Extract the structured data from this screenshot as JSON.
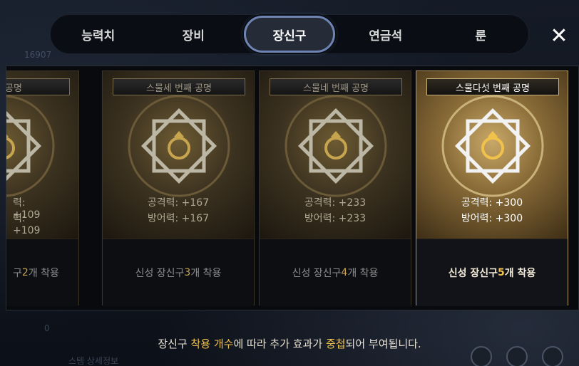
{
  "tabs": [
    {
      "label": "능력치"
    },
    {
      "label": "장비"
    },
    {
      "label": "장신구",
      "active": true
    },
    {
      "label": "연금석"
    },
    {
      "label": "룬"
    }
  ],
  "close_icon": "close-icon",
  "background": {
    "num1": "16907",
    "num2": "0",
    "label": "스템 상세정보"
  },
  "cards": [
    {
      "title": "번째 공명",
      "attack": "+109",
      "defense": "+109",
      "attack_text": "력: +109",
      "defense_text": "력: +109",
      "footer_prefix": "구 ",
      "count": "2",
      "footer_suffix": "개 착용"
    },
    {
      "title": "스물세 번째 공명",
      "attack_text": "공격력: +167",
      "defense_text": "방어력: +167",
      "footer_prefix": "신성 장신구 ",
      "count": "3",
      "footer_suffix": "개 착용"
    },
    {
      "title": "스물네 번째 공명",
      "attack_text": "공격력: +233",
      "defense_text": "방어력: +233",
      "footer_prefix": "신성 장신구 ",
      "count": "4",
      "footer_suffix": "개 착용"
    },
    {
      "title": "스물다섯 번째 공명",
      "attack_text": "공격력: +300",
      "defense_text": "방어력: +300",
      "footer_prefix": "신성 장신구 ",
      "count": "5",
      "footer_suffix": "개 착용",
      "active": true
    }
  ],
  "info": {
    "p1": "장신구 ",
    "h1": "착용 개수",
    "p2": "에 따라 추가 효과가 ",
    "h2": "중첩",
    "p3": "되어 부여됩니다."
  },
  "colors": {
    "accent_gold": "#f0c24c",
    "active_tab_border": "#6e85b4"
  }
}
